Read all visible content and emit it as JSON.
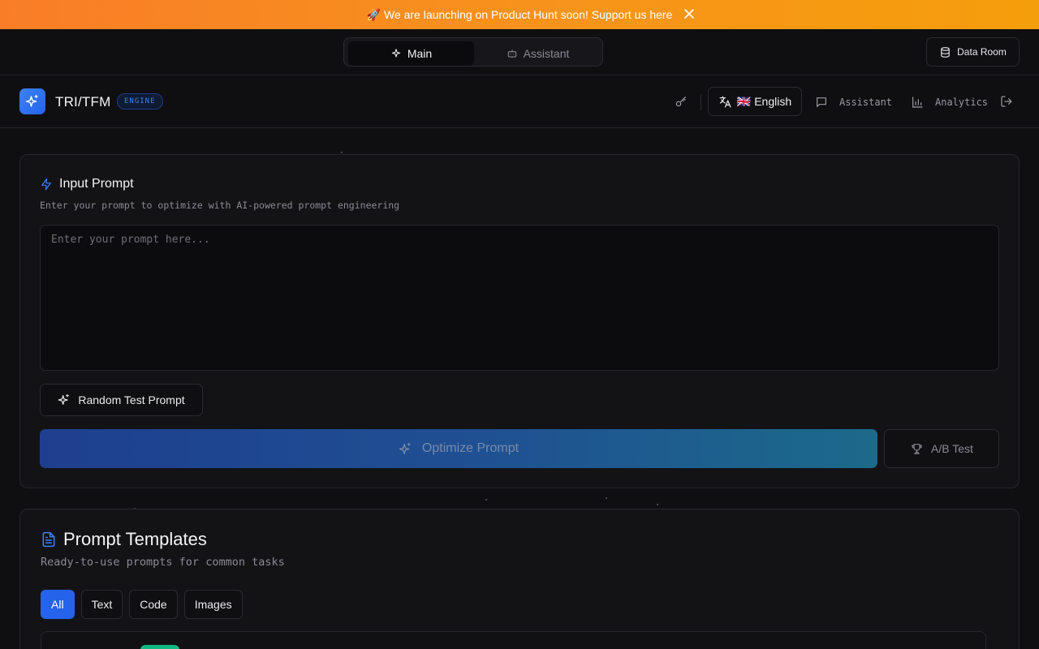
{
  "banner": {
    "text": "🚀 We are launching on Product Hunt soon! Support us here",
    "close_icon": "close-icon"
  },
  "mode_switch": {
    "tabs": [
      {
        "label": "Main",
        "icon": "sparkles-icon",
        "active": true
      },
      {
        "label": "Assistant",
        "icon": "bot-icon",
        "active": false
      }
    ]
  },
  "data_room": {
    "label": "Data Room",
    "icon": "database-icon"
  },
  "header": {
    "brand": "TRI/TFM",
    "badge": "ENGINE",
    "language": "🇬🇧 English",
    "nav": [
      {
        "label": "Assistant",
        "icon": "message-square-icon"
      },
      {
        "label": "Analytics",
        "icon": "bar-chart-icon"
      }
    ]
  },
  "input_section": {
    "title": "Input Prompt",
    "subtitle": "Enter your prompt to optimize with AI-powered prompt engineering",
    "placeholder": "Enter your prompt here...",
    "value": "",
    "random_button": "Random Test Prompt",
    "optimize_button": "Optimize Prompt",
    "ab_button": "A/B Test"
  },
  "templates_section": {
    "title": "Prompt Templates",
    "subtitle": "Ready-to-use prompts for common tasks",
    "filters": [
      {
        "label": "All",
        "active": true
      },
      {
        "label": "Text",
        "active": false
      },
      {
        "label": "Code",
        "active": false
      },
      {
        "label": "Images",
        "active": false
      }
    ]
  },
  "colors": {
    "accent": "#2563eb",
    "banner_start": "#f97d28",
    "banner_end": "#f59e0b",
    "badge_green": "#10b981",
    "background": "#0f0f11"
  }
}
